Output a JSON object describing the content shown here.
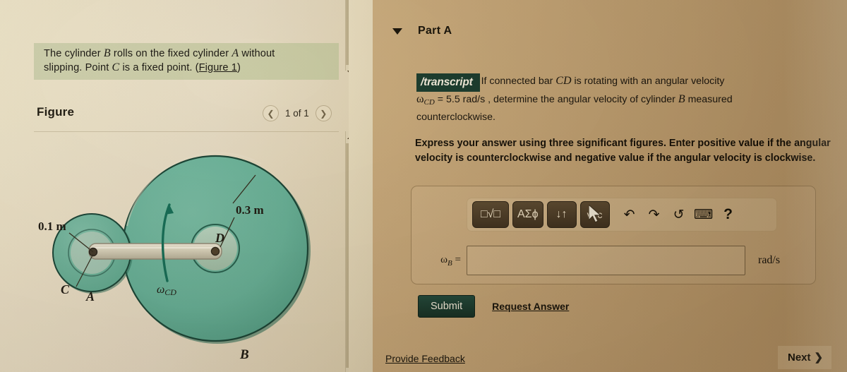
{
  "left_panel": {
    "prompt": {
      "line1_a": "The cylinder ",
      "line1_b": "B",
      "line1_c": " rolls on the fixed cylinder ",
      "line1_d": "A",
      "line1_e": " without",
      "line2_a": "slipping. Point ",
      "line2_b": "C",
      "line2_c": " is a fixed point. (",
      "line2_link": "Figure 1",
      "line2_d": ")"
    },
    "figure_title": "Figure",
    "pager": {
      "prev_icon": "chevron-left-icon",
      "label": "1 of 1",
      "next_icon": "chevron-right-icon"
    },
    "figure": {
      "label_small_radius": "0.1 m",
      "label_large_radius": "0.3 m",
      "label_point_c": "C",
      "label_cylinder_a": "A",
      "label_point_d": "D",
      "label_cylinder_b": "B",
      "label_omega_cd": "ω",
      "label_omega_cd_sub": "CD",
      "colors": {
        "cylinder_fill": "#63b39d",
        "cylinder_edge": "#0f5c47",
        "bar_fill": "#d6d2be",
        "arrow": "#0d6b55"
      }
    },
    "scrollbars": {
      "top_scrollbar": "vertical-scrollbar-top",
      "bottom_scrollbar": "vertical-scrollbar-bottom"
    }
  },
  "right_panel": {
    "part": {
      "caret_icon": "caret-down-icon",
      "title": "Part A"
    },
    "question": {
      "badge": "/transcript",
      "text_a": "If connected bar ",
      "text_b": "CD",
      "text_c": " is rotating with an angular velocity",
      "text_d": "ω",
      "text_d_sub": "CD",
      "text_e": " = 5.5  rad/s , determine the angular velocity of cylinder ",
      "text_f": "B",
      "text_g": " measured",
      "text_h": "counterclockwise."
    },
    "instruction": "Express your answer using three significant figures. Enter positive value if the angular velocity is counterclockwise and negative value if the angular velocity is clockwise.",
    "mathbar": {
      "buttons": [
        {
          "name": "template-sqrt-button",
          "label": "□√□"
        },
        {
          "name": "greek-symbols-button",
          "label": "ΑΣϕ"
        },
        {
          "name": "sort-updown-button",
          "label": "↓↑"
        },
        {
          "name": "vector-button",
          "label": "vec"
        }
      ],
      "icons": [
        {
          "name": "undo-icon",
          "glyph": "↶"
        },
        {
          "name": "redo-icon",
          "glyph": "↷"
        },
        {
          "name": "reset-icon",
          "glyph": "↺"
        },
        {
          "name": "keyboard-icon",
          "glyph": "⌨"
        },
        {
          "name": "help-icon",
          "glyph": "?"
        }
      ]
    },
    "answer": {
      "variable": "ω",
      "variable_sub": "B",
      "equals": "=",
      "value": "",
      "placeholder": "",
      "unit": "rad/s"
    },
    "actions": {
      "submit_label": "Submit",
      "request_answer_label": "Request Answer"
    },
    "footer": {
      "feedback_label": "Provide Feedback",
      "next_label": "Next",
      "next_icon": "chevron-right-icon"
    }
  }
}
